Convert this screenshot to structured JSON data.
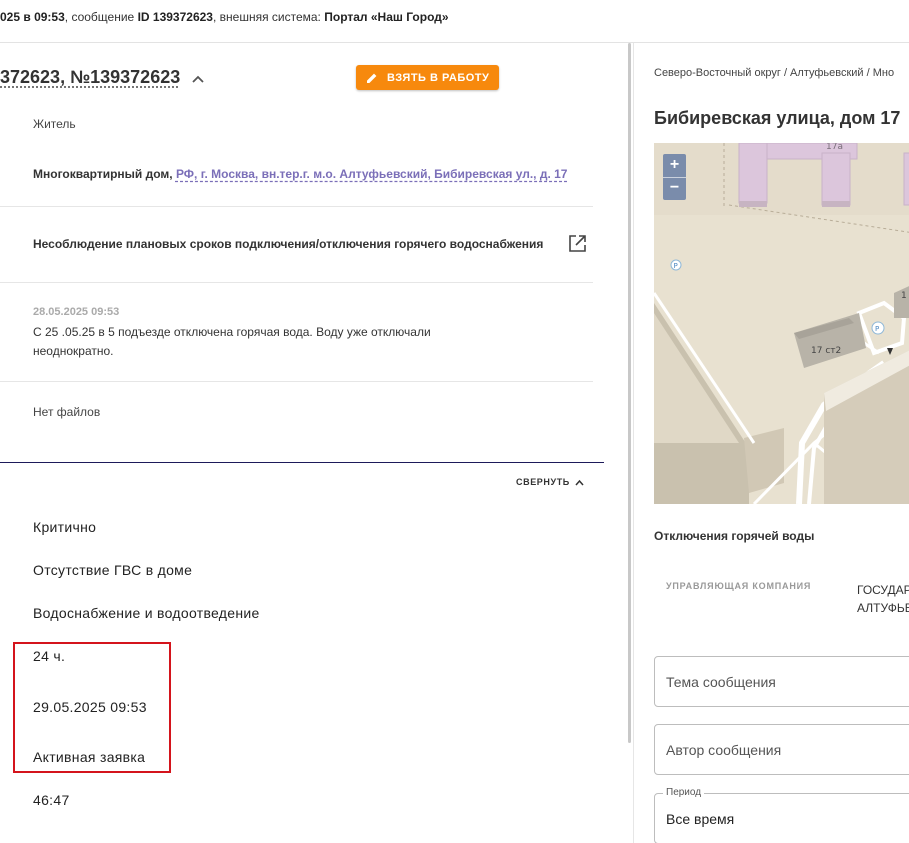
{
  "topbar": {
    "date_part": "025 в ",
    "time": "09:53",
    "mid": ", сообщение ",
    "msg_id": "ID 139372623",
    "ext_prefix": ", внешняя система: ",
    "ext_system": "Портал «Наш Город»"
  },
  "request": {
    "title": "372623, №139372623",
    "take_button": "ВЗЯТЬ В РАБОТУ",
    "applicant": "Житель",
    "address_prefix": "Многоквартирный дом, ",
    "address_link": "РФ, г. Москва, вн.тер.г. м.о. Алтуфьевский, Бибиревская ул., д. 17",
    "topic": "Несоблюдение плановых сроков подключения/отключения горячего водоснабжения",
    "message_date": "28.05.2025 09:53",
    "message_text": "С 25 .05.25 в 5 подъезде отключена горячая вода. Воду уже отключали неоднократно.",
    "files": "Нет файлов",
    "collapse": "СВЕРНУТЬ",
    "priority": "Критично",
    "problem": "Отсутствие ГВС в доме",
    "category": "Водоснабжение и водоотведение",
    "deadline_hours": "24 ч.",
    "due_date": "29.05.2025 09:53",
    "status": "Активная заявка",
    "remaining": "46:47"
  },
  "right": {
    "breadcrumb": "Северо-Восточный округ / Алтуфьевский / Мно",
    "house_title": "Бибиревская улица, дом 17",
    "map": {
      "zoom_in": "+",
      "zoom_out": "−",
      "label_17a": "17а",
      "label_17st2": "17 ст2",
      "label_partial": "1",
      "parking": "P"
    },
    "outage_title": "Отключения горячей воды",
    "uk_label": "УПРАВЛЯЮЩАЯ КОМПАНИЯ",
    "uk_value_line1": "ГОСУДАР",
    "uk_value_line2": "АЛТУФЬЕ",
    "fields": {
      "topic_placeholder": "Тема сообщения",
      "author_placeholder": "Автор сообщения",
      "period_label": "Период",
      "period_value": "Все время"
    }
  },
  "colors": {
    "accent_orange": "#f7890d",
    "link_purple": "#7b6fb8",
    "highlight_red": "#d4141c",
    "divider_dark": "#1d1a5a"
  }
}
